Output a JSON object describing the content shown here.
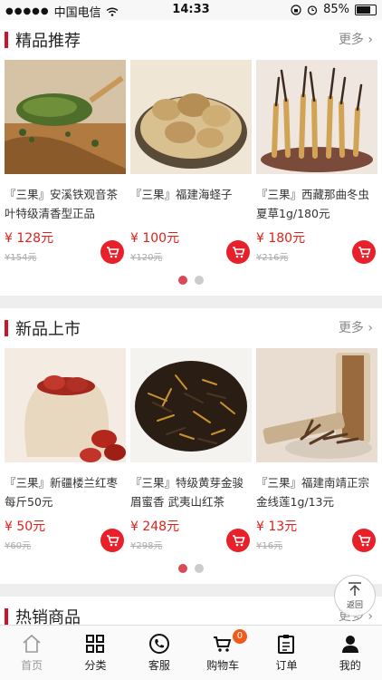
{
  "status": {
    "carrier": "中国电信",
    "time": "14:33",
    "battery": "85%",
    "battery_level": 0.85
  },
  "sections": [
    {
      "title": "精品推荐",
      "more": "更多 ›",
      "products": [
        {
          "name": "『三果』安溪铁观音茶叶特级清香型正品",
          "price": "¥ 128元",
          "original_price": "¥154元"
        },
        {
          "name": "『三果』福建海蛏子",
          "price": "¥ 100元",
          "original_price": "¥120元"
        },
        {
          "name": "『三果』西藏那曲冬虫夏草1g/180元",
          "price": "¥ 180元",
          "original_price": "¥216元"
        }
      ]
    },
    {
      "title": "新品上市",
      "more": "更多 ›",
      "products": [
        {
          "name": "『三果』新疆楼兰红枣每斤50元",
          "price": "¥ 50元",
          "original_price": "¥60元"
        },
        {
          "name": "『三果』特级黄芽金骏眉蜜香 武夷山红茶",
          "price": "¥ 248元",
          "original_price": "¥298元"
        },
        {
          "name": "『三果』福建南靖正宗金线莲1g/13元",
          "price": "¥ 13元",
          "original_price": "¥16元"
        }
      ]
    },
    {
      "title": "热销商品",
      "more": "更多 ›"
    }
  ],
  "back_to_top": "返回",
  "tabbar": [
    {
      "label": "首页"
    },
    {
      "label": "分类"
    },
    {
      "label": "客服"
    },
    {
      "label": "购物车",
      "badge": "0"
    },
    {
      "label": "订单"
    },
    {
      "label": "我的"
    }
  ],
  "colors": {
    "accent": "#d0112b",
    "price": "#e0201a",
    "cart_button": "#e8202a",
    "badge": "#f05a1a"
  }
}
